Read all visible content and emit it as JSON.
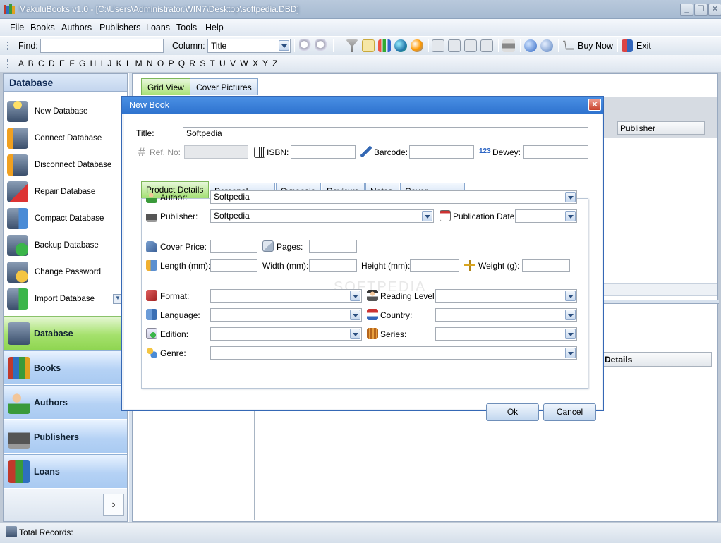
{
  "window": {
    "title": "MakuluBooks v1.0 - [C:\\Users\\Administrator.WIN7\\Desktop\\softpedia.DBD]",
    "minimize": "_",
    "restore": "❐",
    "close": "✕"
  },
  "menu": [
    "File",
    "Books",
    "Authors",
    "Publishers",
    "Loans",
    "Tools",
    "Help"
  ],
  "toolbar": {
    "find_label": "Find:",
    "find_value": "",
    "column_label": "Column:",
    "column_value": "Title",
    "buy_now": "Buy Now",
    "exit": "Exit"
  },
  "alphabet": "A B C D E F G H I J K L M N O P Q R S T U V W X Y Z",
  "left_panel": {
    "header": "Database",
    "items": [
      {
        "label": "New Database",
        "icon": "new-database-icon"
      },
      {
        "label": "Connect Database",
        "icon": "connect-database-icon"
      },
      {
        "label": "Disconnect Database",
        "icon": "disconnect-database-icon"
      },
      {
        "label": "Repair Database",
        "icon": "repair-database-icon"
      },
      {
        "label": "Compact Database",
        "icon": "compact-database-icon"
      },
      {
        "label": "Backup Database",
        "icon": "backup-database-icon"
      },
      {
        "label": "Change Password",
        "icon": "change-password-icon"
      },
      {
        "label": "Import Database",
        "icon": "import-database-icon"
      }
    ],
    "nav": [
      {
        "label": "Database",
        "active": true
      },
      {
        "label": "Books",
        "active": false
      },
      {
        "label": "Authors",
        "active": false
      },
      {
        "label": "Publishers",
        "active": false
      },
      {
        "label": "Loans",
        "active": false
      }
    ],
    "more": "›"
  },
  "main": {
    "tabs": [
      "Grid View",
      "Cover Pictures"
    ],
    "col_publisher": "Publisher",
    "col_details": "Details"
  },
  "status": {
    "label": "Total Records:"
  },
  "dialog": {
    "title": "New Book",
    "close": "✕",
    "title_label": "Title:",
    "title_value": "Softpedia",
    "refno_label": "Ref. No:",
    "isbn_label": "ISBN:",
    "barcode_label": "Barcode:",
    "dewey_label": "Dewey:",
    "dewey_icon_text": "123",
    "tabs": [
      "Product Details",
      "Personal Details",
      "Synopsis",
      "Reviews",
      "Notes",
      "Cover Pictures"
    ],
    "author_label": "Author:",
    "author_value": "Softpedia",
    "publisher_label": "Publisher:",
    "publisher_value": "Softpedia",
    "pubdate_label": "Publication Date:",
    "cover_price_label": "Cover Price:",
    "pages_label": "Pages:",
    "length_label": "Length (mm):",
    "width_label": "Width (mm):",
    "height_label": "Height (mm):",
    "weight_label": "Weight (g):",
    "format_label": "Format:",
    "reading_level_label": "Reading Level:",
    "language_label": "Language:",
    "country_label": "Country:",
    "edition_label": "Edition:",
    "series_label": "Series:",
    "genre_label": "Genre:",
    "ok": "Ok",
    "cancel": "Cancel",
    "watermark": "SOFTPEDIA"
  }
}
